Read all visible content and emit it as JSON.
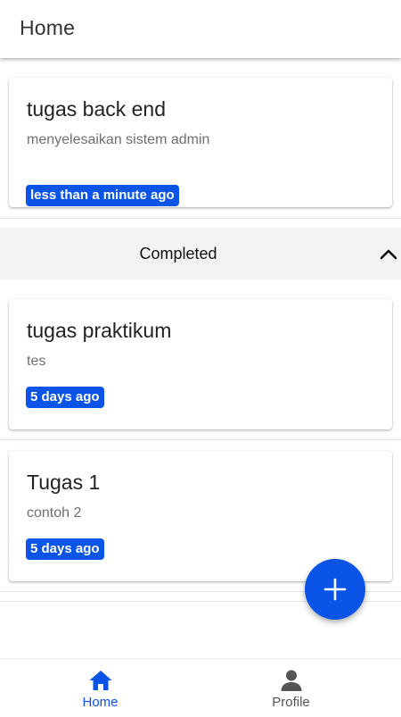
{
  "app_bar": {
    "title": "Home"
  },
  "tasks": [
    {
      "title": "tugas back end",
      "description": "menyelesaikan sistem admin",
      "time": "less than a minute ago"
    }
  ],
  "completed_section": {
    "title": "Completed",
    "icon": "chevron-up-icon",
    "tasks": [
      {
        "title": "tugas praktikum",
        "description": "tes",
        "time": "5 days ago"
      },
      {
        "title": "Tugas 1",
        "description": "contoh 2",
        "time": "5 days ago"
      }
    ]
  },
  "fab": {
    "icon": "plus-icon"
  },
  "bottom_nav": {
    "items": [
      {
        "label": "Home",
        "icon": "home-icon",
        "active": true
      },
      {
        "label": "Profile",
        "icon": "person-icon",
        "active": false
      }
    ]
  },
  "colors": {
    "accent": "#0a55e8",
    "inactive": "#555555",
    "section_bg": "#f2f3f5"
  }
}
